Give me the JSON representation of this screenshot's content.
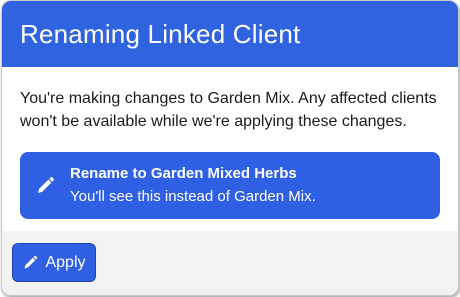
{
  "dialog": {
    "title": "Renaming Linked Client",
    "message": "You're making changes to Garden Mix. Any affected clients won't be available while we're applying these changes.",
    "rename_card": {
      "icon": "pencil-icon",
      "title": "Rename to Garden Mixed Herbs",
      "subtitle": "You'll see this instead of Garden Mix."
    },
    "footer": {
      "apply_label": "Apply",
      "apply_icon": "pencil-icon"
    }
  },
  "colors": {
    "header_bg": "#2f63e0",
    "accent": "#2f5fe3",
    "footer_bg": "#f2f2f2",
    "text": "#1a1a1a"
  }
}
